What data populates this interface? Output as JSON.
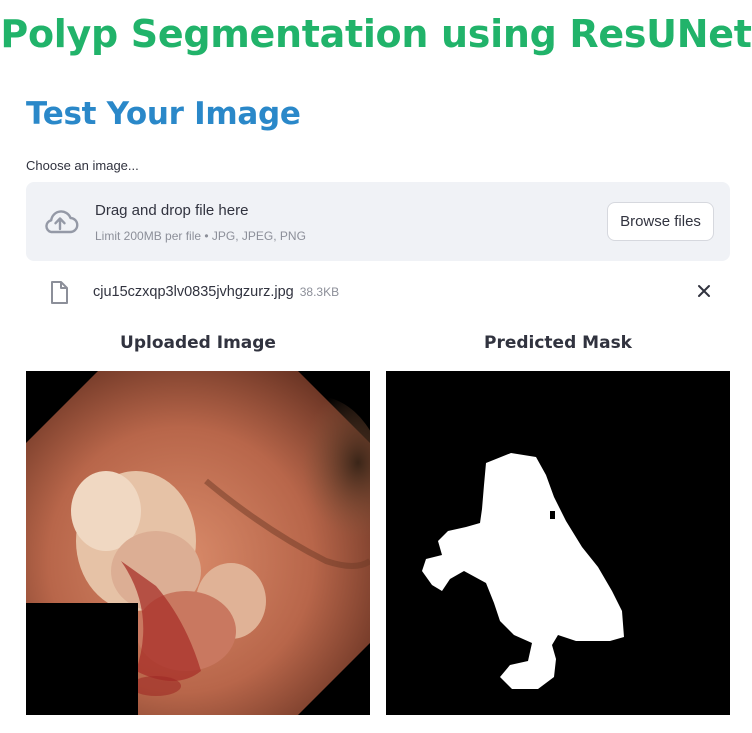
{
  "page": {
    "title": "Polyp Segmentation using ResUNet",
    "subheader": "Test Your Image"
  },
  "uploader": {
    "label": "Choose an image...",
    "drop_text": "Drag and drop file here",
    "limit_text": "Limit 200MB per file • JPG, JPEG, PNG",
    "browse_label": "Browse files",
    "upload_icon": "cloud-upload-icon"
  },
  "uploaded_file": {
    "name": "cju15czxqp3lv0835jvhgzurz.jpg",
    "size": "38.3KB",
    "icon": "file-icon",
    "remove_icon": "close-icon"
  },
  "columns": {
    "left_caption": "Uploaded Image",
    "right_caption": "Predicted Mask"
  },
  "colors": {
    "title": "#21b36a",
    "subheader": "#2a88c9",
    "dropzone_bg": "#f0f2f6"
  }
}
